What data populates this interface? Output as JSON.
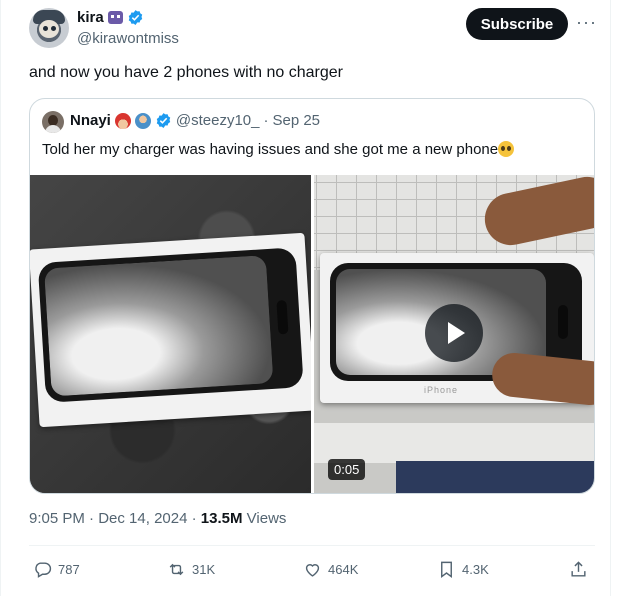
{
  "author": {
    "name": "kira",
    "handle": "@kirawontmiss"
  },
  "header": {
    "subscribe_label": "Subscribe",
    "more_label": "···"
  },
  "tweet": {
    "text": "and now you have 2 phones with no charger"
  },
  "quote": {
    "name": "Nnayi",
    "handle": "@steezy10_",
    "separator": "·",
    "date": "Sep 25",
    "text": "Told her my charger was having issues and she got me a new phone",
    "video_duration": "0:05",
    "box_label": "iPhone"
  },
  "meta": {
    "time": "9:05 PM",
    "separator": "·",
    "date": "Dec 14, 2024",
    "views_count": "13.5M",
    "views_label": "Views"
  },
  "actions": {
    "replies": "787",
    "reposts": "31K",
    "likes": "464K",
    "bookmarks": "4.3K"
  },
  "colors": {
    "verified": "#1d9bf0",
    "text_secondary": "#536471",
    "subscribe_bg": "#0f1419"
  }
}
